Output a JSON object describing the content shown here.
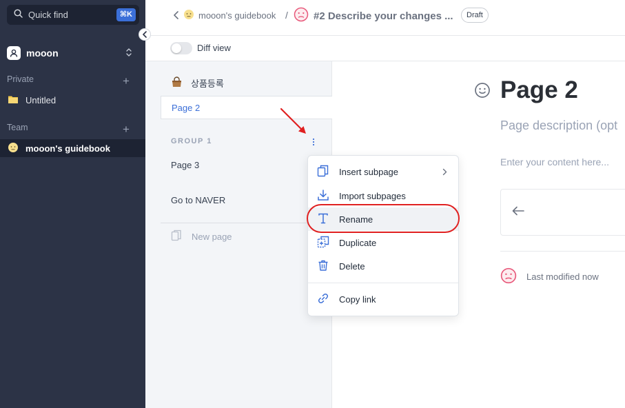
{
  "sidebar": {
    "quick_find": {
      "label": "Quick find",
      "shortcut": "⌘K"
    },
    "workspace": {
      "name": "mooon"
    },
    "private": {
      "label": "Private",
      "items": [
        {
          "label": "Untitled"
        }
      ]
    },
    "team": {
      "label": "Team",
      "items": [
        {
          "label": "mooon's guidebook"
        }
      ]
    }
  },
  "header": {
    "breadcrumb_root": "mooon's guidebook",
    "separator": "/",
    "doc_title": "#2  Describe your changes ...",
    "status_badge": "Draft"
  },
  "diffbar": {
    "label": "Diff view",
    "enabled": false
  },
  "pagelist": {
    "items": [
      {
        "label": "상품등록"
      },
      {
        "label": "Page 2",
        "selected": true
      }
    ],
    "group": {
      "label": "GROUP 1",
      "items": [
        {
          "label": "Page 3"
        },
        {
          "label": "Go to NAVER"
        }
      ]
    },
    "new_page": "New page"
  },
  "editor": {
    "title": "Page 2",
    "description_placeholder": "Page description (opt",
    "content_placeholder": "Enter your content here...",
    "last_modified": "Last modified now"
  },
  "context_menu": {
    "items": [
      {
        "label": "Insert subpage",
        "icon": "copy-pages-icon"
      },
      {
        "label": "Import subpages",
        "icon": "download-icon"
      },
      {
        "label": "Rename",
        "icon": "text-t-icon"
      },
      {
        "label": "Duplicate",
        "icon": "duplicate-icon"
      },
      {
        "label": "Delete",
        "icon": "trash-icon"
      },
      {
        "label": "Copy link",
        "icon": "link-icon"
      }
    ]
  },
  "colors": {
    "sidebar_bg": "#2c3346",
    "accent": "#3b6fd8",
    "highlight": "#e02020"
  }
}
